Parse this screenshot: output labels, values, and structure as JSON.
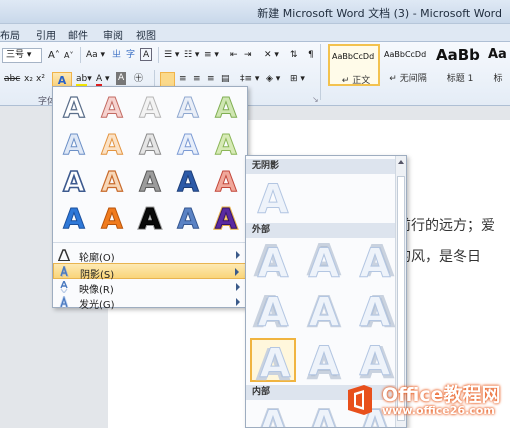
{
  "window": {
    "title": "新建 Microsoft Word 文档 (3) - Microsoft Word"
  },
  "tabs": [
    "布局",
    "引用",
    "邮件",
    "审阅",
    "视图"
  ],
  "ribbon": {
    "font_size": "三号",
    "grow_font": "A",
    "shrink_font": "A",
    "change_case": "Aa",
    "font_group_label": "字体",
    "styles": [
      {
        "sample": "AaBbCcDd",
        "name": "↵ 正文"
      },
      {
        "sample": "AaBbCcDd",
        "name": "↵ 无间隔"
      },
      {
        "sample": "AaBb",
        "name": "标题 1"
      },
      {
        "sample": "Aa",
        "name": "标"
      }
    ]
  },
  "document": {
    "lines": [
      "前行的远方；爱",
      "的风，是冬日"
    ]
  },
  "text_effects_menu": {
    "menu_items": [
      {
        "label": "轮廓(O)",
        "icon": "outline-icon"
      },
      {
        "label": "阴影(S)",
        "icon": "shadow-icon"
      },
      {
        "label": "映像(R)",
        "icon": "reflection-icon"
      },
      {
        "label": "发光(G)",
        "icon": "glow-icon"
      }
    ]
  },
  "shadow_submenu": {
    "sections": [
      "无阴影",
      "外部",
      "内部"
    ],
    "glyph": "A"
  },
  "watermark": {
    "brand_office": "Office",
    "brand_cn": "教程网",
    "url": "www.office26.com"
  },
  "colors": {
    "accent_orange": "#f0b44a",
    "ribbon_blue": "#dfe8f3",
    "watermark_orange": "#e85a1c"
  }
}
